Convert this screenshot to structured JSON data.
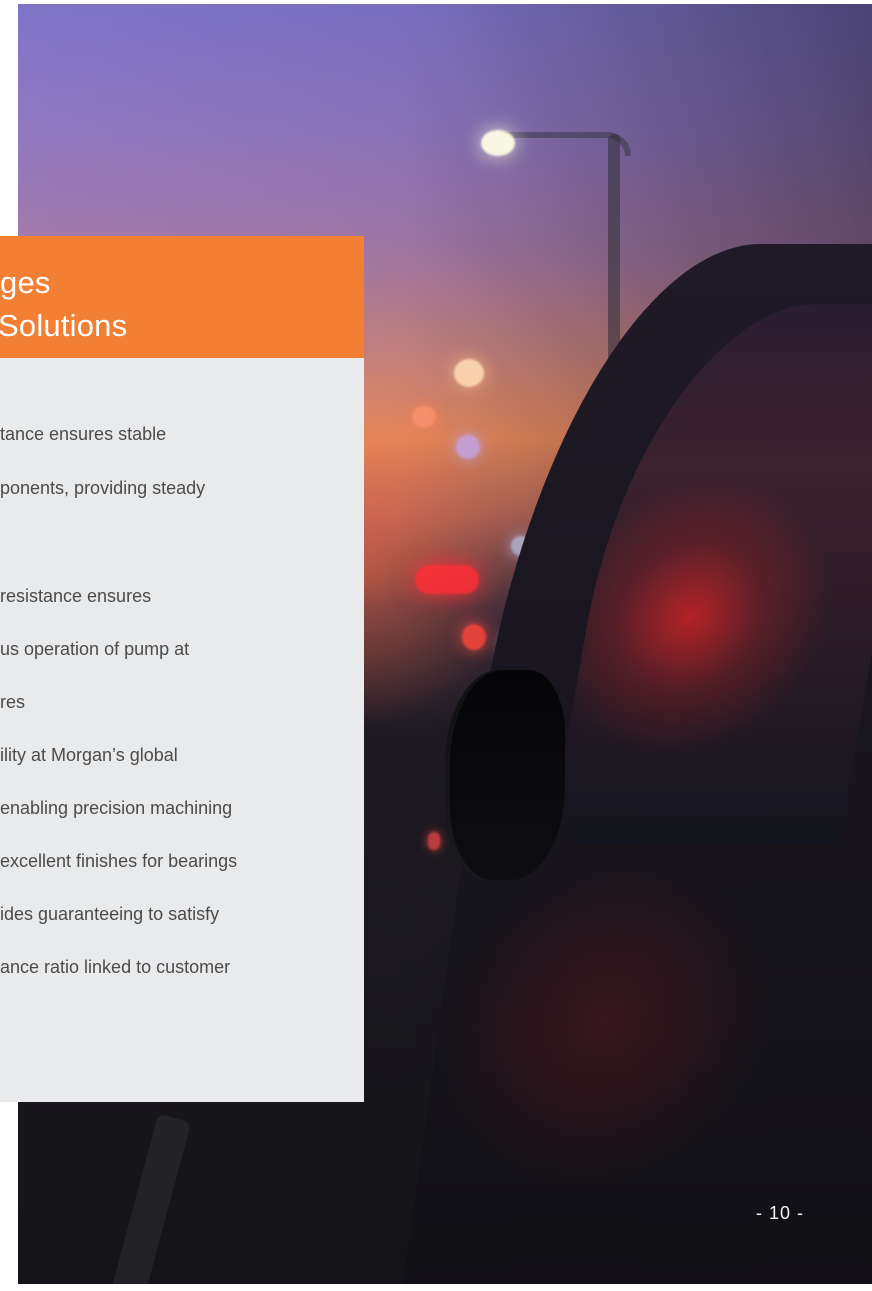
{
  "slide": {
    "title_lines": [
      "ges",
      "Solutions"
    ],
    "body_lines": [
      "tance ensures stable",
      "ponents, providing steady",
      "resistance ensures",
      "us operation of pump at",
      "res",
      "ility at Morgan’s global",
      "enabling precision machining",
      "excellent finishes for bearings",
      "ides guaranteeing to satisfy",
      "ance ratio linked to customer"
    ],
    "page_number": "- 10 -"
  },
  "colors": {
    "title_background": "#f37f34",
    "body_background": "#e9eaec",
    "body_text": "#4b4b4b",
    "page_number": "#f3f3f3"
  }
}
